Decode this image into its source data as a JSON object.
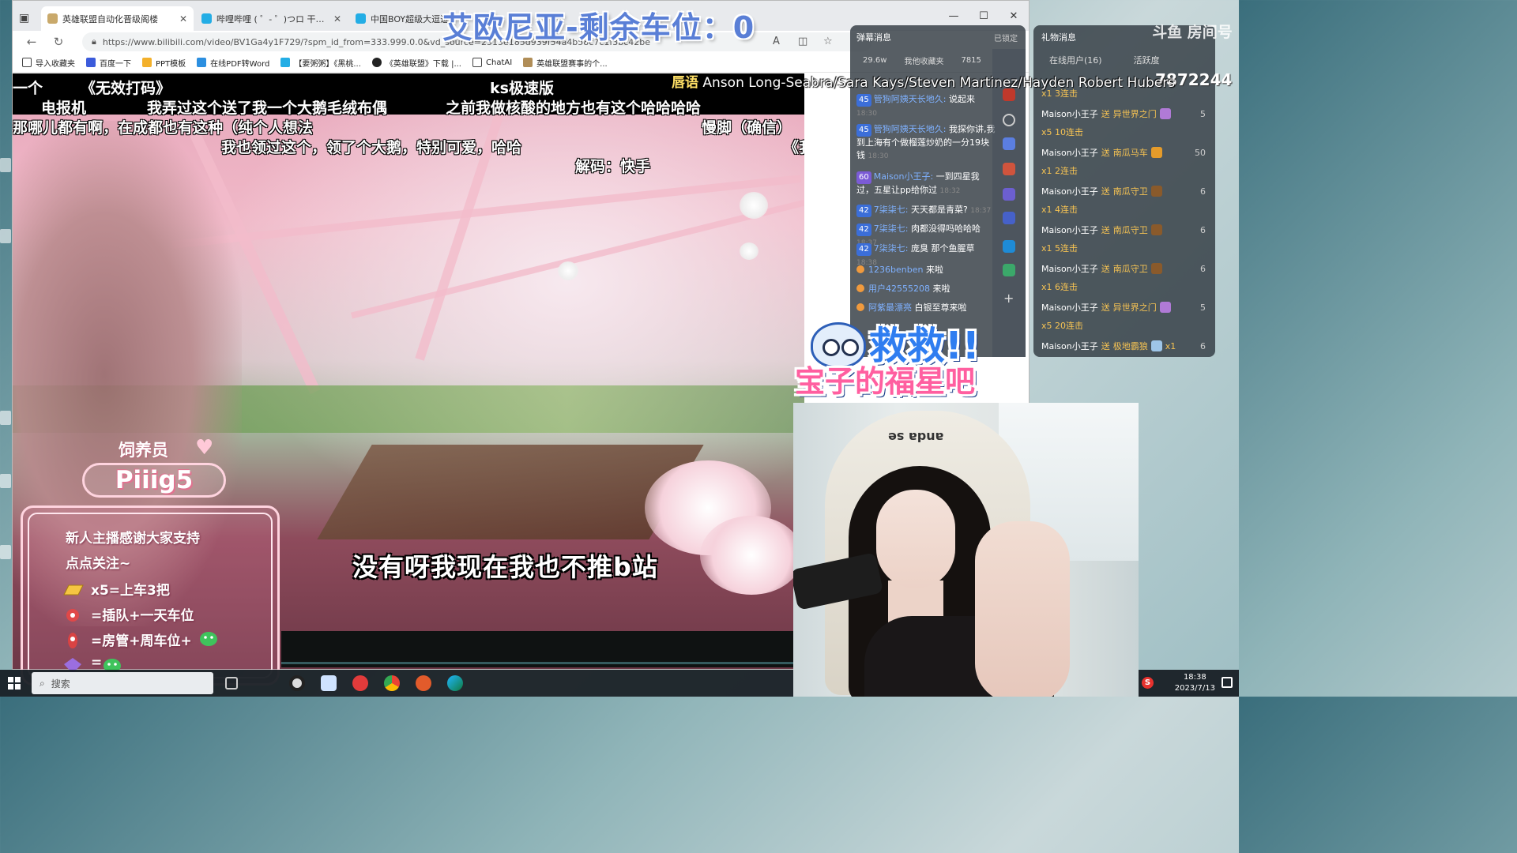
{
  "browser": {
    "tabs": [
      {
        "title": "英雄联盟自动化晋级阁楼",
        "active": true
      },
      {
        "title": "哔哩哔哩 ( ゜- ゜)つロ 干杯~-bilibili",
        "active": false
      },
      {
        "title": "中国BOY超级大逗逗",
        "active": false
      }
    ],
    "url": "https://www.bilibili.com/video/BV1Ga4y1F729/?spm_id_from=333.999.0.0&vd_source=2515e185d939f54a4b58c7c1f3bc42be",
    "bookmarks": [
      "导入收藏夹",
      "百度一下",
      "PPT模板",
      "在线PDF转Word",
      "【要粥粥】《黑桃...",
      "《英雄联盟》下载 |...",
      "ChatAI",
      "英雄联盟赛事的个..."
    ]
  },
  "overlay": {
    "seats_title": "艾欧尼亚-剩余车位：0",
    "room_number": "7872244",
    "room_logo": "斗鱼 房间号",
    "song_ticker_lyric": "唇语",
    "song_ticker_artists": "Anson Long-Seabra/Sara Kays/Steven Martinez/Hayden Robert Hubers"
  },
  "danmaku": [
    "一个",
    "《无效打码》",
    "ks极速版",
    "电报机",
    "我弄过这个送了我一个大鹅毛绒布偶",
    "之前我做核酸的地方也有这个哈哈哈哈",
    "那哪儿都有啊，在成都也有这种（纯个人想法",
    "慢脚（确信）",
    "我也领过这个，领了个大鹅，特别可爱，哈哈",
    "《我推的b站》",
    "解码：快手"
  ],
  "subtitle": "没有呀我现在我也不推b站",
  "keeper": {
    "label": "饲养员",
    "name": "Piiig5"
  },
  "notice": {
    "title": "新人主播感谢大家支持",
    "subtitle": "点点关注~",
    "rules": [
      "x5=上车3把",
      "=插队+一天车位",
      "=房管+周车位+",
      "="
    ]
  },
  "chat": {
    "tab_label": "弹幕消息",
    "lock_label": "已锁定",
    "stats": [
      "29.6w",
      "我他收藏夹",
      "7815"
    ],
    "messages": [
      {
        "badge": "45",
        "user": "管狗阿姨天长地久:",
        "text": "说起来",
        "time": "18:30"
      },
      {
        "badge": "45",
        "user": "管狗阿姨天长地久:",
        "text": "我探你讲,我到上海有个做榴莲炒奶的一分19块钱",
        "time": "18:30"
      },
      {
        "badge": "60",
        "user": "Maison小王子:",
        "text": "一到四星我过，五星让pp给你过",
        "time": "18:32"
      },
      {
        "badge": "42",
        "user": "7柒柒七:",
        "text": "天天都是青菜?",
        "time": "18:37"
      },
      {
        "badge": "42",
        "user": "7柒柒七:",
        "text": "肉都没得吗哈哈哈",
        "time": "18:37"
      },
      {
        "badge": "42",
        "user": "7柒柒七:",
        "text": "庞臭 那个鱼腥草",
        "time": "18:38"
      },
      {
        "badge": "",
        "user": "1236benben",
        "text": "来啦",
        "time": ""
      },
      {
        "badge": "",
        "user": "用户42555208",
        "text": "来啦",
        "time": ""
      },
      {
        "badge": "",
        "user": "阿紫最漂亮",
        "text": "白银至尊来啦",
        "time": ""
      }
    ]
  },
  "gifts": {
    "tab_label": "礼物消息",
    "online_label": "在线用户(16)",
    "active_label": "活跃度",
    "top_combo": "x1 3连击",
    "rows": [
      {
        "user": "Maison小王子",
        "action": "送",
        "gift": "异世界之门",
        "count": "5",
        "combo": "x5 10连击"
      },
      {
        "user": "Maison小王子",
        "action": "送",
        "gift": "南瓜马车",
        "count": "50",
        "combo": "x1 2连击"
      },
      {
        "user": "Maison小王子",
        "action": "送",
        "gift": "南瓜守卫",
        "count": "6",
        "combo": "x1 4连击"
      },
      {
        "user": "Maison小王子",
        "action": "送",
        "gift": "南瓜守卫",
        "count": "6",
        "combo": "x1 5连击"
      },
      {
        "user": "Maison小王子",
        "action": "送",
        "gift": "南瓜守卫",
        "count": "6",
        "combo": "x1 6连击"
      },
      {
        "user": "Maison小王子",
        "action": "送",
        "gift": "异世界之门",
        "count": "5",
        "combo": "x5 20连击"
      },
      {
        "user": "Maison小王子",
        "action": "送",
        "gift": "极地霸狼",
        "count": "6",
        "combo": "x1"
      }
    ]
  },
  "sticker": {
    "line1": "救救!!",
    "line2": "宝子的福星吧"
  },
  "webcam": {
    "chair_text": "anda se"
  },
  "taskbar": {
    "search_placeholder": "搜索",
    "time": "18:38",
    "date": "2023/7/13"
  }
}
